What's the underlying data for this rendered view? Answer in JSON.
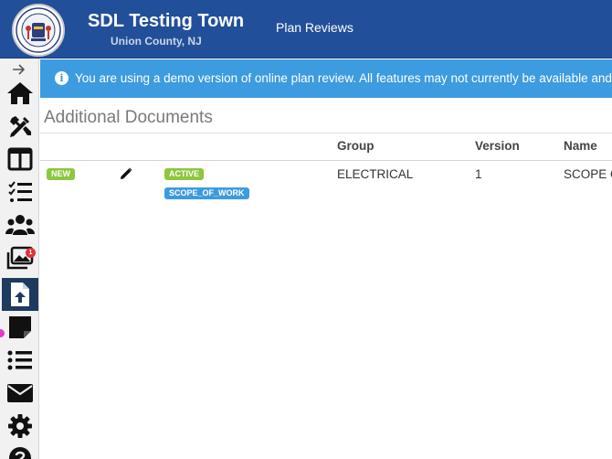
{
  "header": {
    "town_name": "SDL Testing Town",
    "county": "Union County, NJ",
    "nav_plan_reviews": "Plan Reviews",
    "brand_color": "#224f99"
  },
  "sidebar": {
    "items": [
      {
        "icon": "home-icon"
      },
      {
        "icon": "tools-icon"
      },
      {
        "icon": "columns-icon"
      },
      {
        "icon": "checklist-icon"
      },
      {
        "icon": "users-icon"
      },
      {
        "icon": "images-icon",
        "badge": "1"
      },
      {
        "icon": "upload-file-icon",
        "active": true
      },
      {
        "icon": "sticky-note-icon"
      },
      {
        "icon": "list-icon"
      },
      {
        "icon": "envelope-icon"
      },
      {
        "icon": "gear-icon"
      },
      {
        "icon": "help-icon"
      }
    ]
  },
  "alert": {
    "text": "You are using a demo version of online plan review. All features may not currently be available and a",
    "color": "#3d9be0"
  },
  "section": {
    "title": "Additional Documents"
  },
  "table": {
    "columns": [
      "Group",
      "Version",
      "Name"
    ],
    "rows": [
      {
        "status_label": "NEW",
        "state_label": "ACTIVE",
        "type_label": "SCOPE_OF_WORK",
        "group": "ELECTRICAL",
        "version": "1",
        "name": "SCOPE O"
      }
    ]
  }
}
